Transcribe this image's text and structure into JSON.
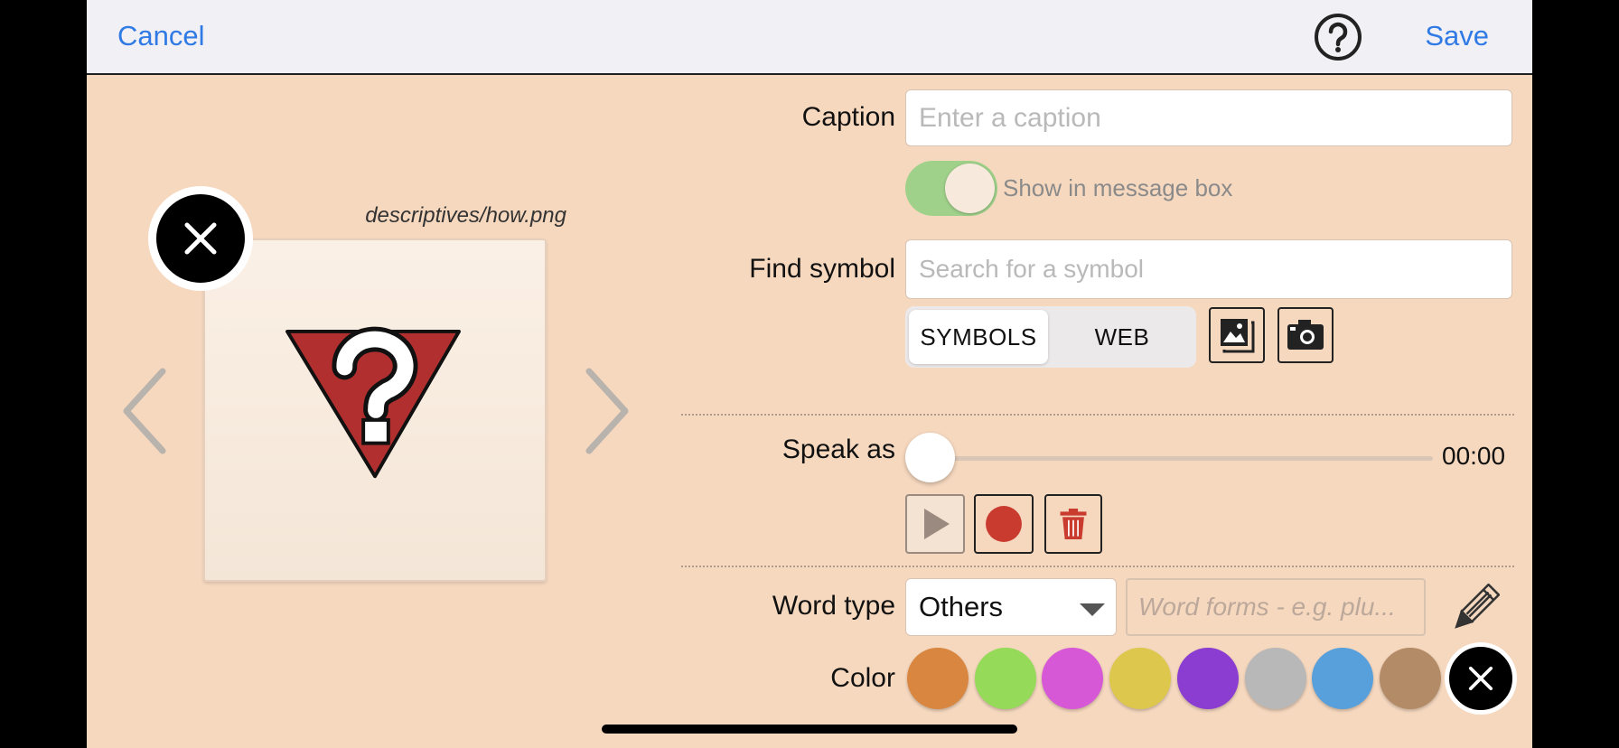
{
  "navbar": {
    "cancel_label": "Cancel",
    "save_label": "Save",
    "help_icon": "question-circle-icon"
  },
  "preview": {
    "filename": "descriptives/how.png",
    "symbol_icon": "question-triangle-icon"
  },
  "caption": {
    "label": "Caption",
    "placeholder": "Enter a caption",
    "value": ""
  },
  "show_in_message_box": {
    "label": "Show in message box",
    "enabled": true
  },
  "find_symbol": {
    "label": "Find symbol",
    "placeholder": "Search for a symbol",
    "tabs": [
      {
        "label": "SYMBOLS",
        "selected": true
      },
      {
        "label": "WEB",
        "selected": false
      }
    ],
    "buttons": [
      "gallery-icon",
      "camera-icon"
    ]
  },
  "speak_as": {
    "label": "Speak as",
    "time": "00:00",
    "progress": 0,
    "buttons": [
      "play-icon",
      "record-icon",
      "trash-icon"
    ]
  },
  "word_type": {
    "label": "Word type",
    "value": "Others",
    "forms_placeholder": "Word forms - e.g. plu..."
  },
  "color": {
    "label": "Color",
    "swatches": [
      "#d98640",
      "#95da58",
      "#d658d6",
      "#ddc84d",
      "#8a3dd0",
      "#b8b8b8",
      "#58a0db",
      "#b48b67"
    ]
  },
  "theme": {
    "background": "#f6d8bf",
    "accent": "#2f7ae5",
    "record_red": "#c93a2f"
  }
}
